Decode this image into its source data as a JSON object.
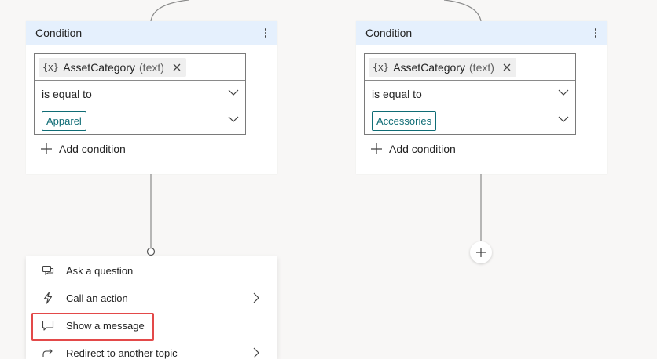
{
  "canvas": {
    "colors": {
      "header_bg": "#e5f0fd",
      "chip_border": "#0f6c75",
      "highlight": "#e34949",
      "connector": "#8a8a8a"
    }
  },
  "conditions": [
    {
      "title": "Condition",
      "variable": {
        "icon": "{x}",
        "name": "AssetCategory",
        "type": "(text)"
      },
      "operator": "is equal to",
      "value": "Apparel",
      "add_condition": "Add condition"
    },
    {
      "title": "Condition",
      "variable": {
        "icon": "{x}",
        "name": "AssetCategory",
        "type": "(text)"
      },
      "operator": "is equal to",
      "value": "Accessories",
      "add_condition": "Add condition"
    }
  ],
  "menu": {
    "items": [
      {
        "label": "Ask a question",
        "icon": "chat-question-icon",
        "has_submenu": false
      },
      {
        "label": "Call an action",
        "icon": "flash-icon",
        "has_submenu": true
      },
      {
        "label": "Show a message",
        "icon": "message-icon",
        "has_submenu": false,
        "highlighted": true
      },
      {
        "label": "Redirect to another topic",
        "icon": "redirect-arrow-icon",
        "has_submenu": true
      }
    ]
  }
}
